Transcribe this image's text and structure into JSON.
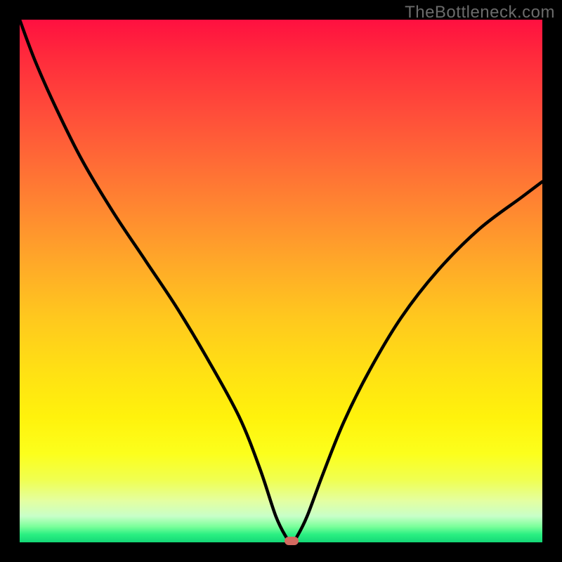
{
  "watermark": "TheBottleneck.com",
  "colors": {
    "frame": "#000000",
    "curve": "#000000",
    "marker": "#d36a60"
  },
  "chart_data": {
    "type": "line",
    "title": "",
    "xlabel": "",
    "ylabel": "",
    "xlim": [
      0,
      100
    ],
    "ylim": [
      0,
      100
    ],
    "grid": false,
    "series": [
      {
        "name": "bottleneck-curve",
        "x": [
          0,
          3,
          7,
          12,
          18,
          24,
          30,
          36,
          42,
          46,
          49,
          51,
          52,
          53,
          55,
          58,
          62,
          67,
          73,
          80,
          88,
          96,
          100
        ],
        "y": [
          100,
          92,
          83,
          73,
          63,
          54,
          45,
          35,
          24,
          14,
          5,
          1,
          0,
          1,
          5,
          13,
          23,
          33,
          43,
          52,
          60,
          66,
          69
        ]
      }
    ],
    "marker": {
      "x": 52,
      "y": 0
    },
    "background_gradient": [
      {
        "pos": 0,
        "color": "#ff1040"
      },
      {
        "pos": 50,
        "color": "#ffc81e"
      },
      {
        "pos": 85,
        "color": "#fcff1c"
      },
      {
        "pos": 100,
        "color": "#14d876"
      }
    ]
  }
}
